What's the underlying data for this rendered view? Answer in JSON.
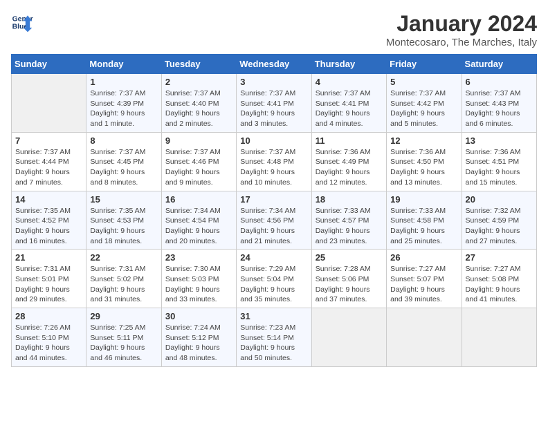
{
  "header": {
    "logo_line1": "General",
    "logo_line2": "Blue",
    "title": "January 2024",
    "subtitle": "Montecosaro, The Marches, Italy"
  },
  "days_of_week": [
    "Sunday",
    "Monday",
    "Tuesday",
    "Wednesday",
    "Thursday",
    "Friday",
    "Saturday"
  ],
  "weeks": [
    [
      {
        "day": "",
        "info": ""
      },
      {
        "day": "1",
        "info": "Sunrise: 7:37 AM\nSunset: 4:39 PM\nDaylight: 9 hours\nand 1 minute."
      },
      {
        "day": "2",
        "info": "Sunrise: 7:37 AM\nSunset: 4:40 PM\nDaylight: 9 hours\nand 2 minutes."
      },
      {
        "day": "3",
        "info": "Sunrise: 7:37 AM\nSunset: 4:41 PM\nDaylight: 9 hours\nand 3 minutes."
      },
      {
        "day": "4",
        "info": "Sunrise: 7:37 AM\nSunset: 4:41 PM\nDaylight: 9 hours\nand 4 minutes."
      },
      {
        "day": "5",
        "info": "Sunrise: 7:37 AM\nSunset: 4:42 PM\nDaylight: 9 hours\nand 5 minutes."
      },
      {
        "day": "6",
        "info": "Sunrise: 7:37 AM\nSunset: 4:43 PM\nDaylight: 9 hours\nand 6 minutes."
      }
    ],
    [
      {
        "day": "7",
        "info": "Sunrise: 7:37 AM\nSunset: 4:44 PM\nDaylight: 9 hours\nand 7 minutes."
      },
      {
        "day": "8",
        "info": "Sunrise: 7:37 AM\nSunset: 4:45 PM\nDaylight: 9 hours\nand 8 minutes."
      },
      {
        "day": "9",
        "info": "Sunrise: 7:37 AM\nSunset: 4:46 PM\nDaylight: 9 hours\nand 9 minutes."
      },
      {
        "day": "10",
        "info": "Sunrise: 7:37 AM\nSunset: 4:48 PM\nDaylight: 9 hours\nand 10 minutes."
      },
      {
        "day": "11",
        "info": "Sunrise: 7:36 AM\nSunset: 4:49 PM\nDaylight: 9 hours\nand 12 minutes."
      },
      {
        "day": "12",
        "info": "Sunrise: 7:36 AM\nSunset: 4:50 PM\nDaylight: 9 hours\nand 13 minutes."
      },
      {
        "day": "13",
        "info": "Sunrise: 7:36 AM\nSunset: 4:51 PM\nDaylight: 9 hours\nand 15 minutes."
      }
    ],
    [
      {
        "day": "14",
        "info": "Sunrise: 7:35 AM\nSunset: 4:52 PM\nDaylight: 9 hours\nand 16 minutes."
      },
      {
        "day": "15",
        "info": "Sunrise: 7:35 AM\nSunset: 4:53 PM\nDaylight: 9 hours\nand 18 minutes."
      },
      {
        "day": "16",
        "info": "Sunrise: 7:34 AM\nSunset: 4:54 PM\nDaylight: 9 hours\nand 20 minutes."
      },
      {
        "day": "17",
        "info": "Sunrise: 7:34 AM\nSunset: 4:56 PM\nDaylight: 9 hours\nand 21 minutes."
      },
      {
        "day": "18",
        "info": "Sunrise: 7:33 AM\nSunset: 4:57 PM\nDaylight: 9 hours\nand 23 minutes."
      },
      {
        "day": "19",
        "info": "Sunrise: 7:33 AM\nSunset: 4:58 PM\nDaylight: 9 hours\nand 25 minutes."
      },
      {
        "day": "20",
        "info": "Sunrise: 7:32 AM\nSunset: 4:59 PM\nDaylight: 9 hours\nand 27 minutes."
      }
    ],
    [
      {
        "day": "21",
        "info": "Sunrise: 7:31 AM\nSunset: 5:01 PM\nDaylight: 9 hours\nand 29 minutes."
      },
      {
        "day": "22",
        "info": "Sunrise: 7:31 AM\nSunset: 5:02 PM\nDaylight: 9 hours\nand 31 minutes."
      },
      {
        "day": "23",
        "info": "Sunrise: 7:30 AM\nSunset: 5:03 PM\nDaylight: 9 hours\nand 33 minutes."
      },
      {
        "day": "24",
        "info": "Sunrise: 7:29 AM\nSunset: 5:04 PM\nDaylight: 9 hours\nand 35 minutes."
      },
      {
        "day": "25",
        "info": "Sunrise: 7:28 AM\nSunset: 5:06 PM\nDaylight: 9 hours\nand 37 minutes."
      },
      {
        "day": "26",
        "info": "Sunrise: 7:27 AM\nSunset: 5:07 PM\nDaylight: 9 hours\nand 39 minutes."
      },
      {
        "day": "27",
        "info": "Sunrise: 7:27 AM\nSunset: 5:08 PM\nDaylight: 9 hours\nand 41 minutes."
      }
    ],
    [
      {
        "day": "28",
        "info": "Sunrise: 7:26 AM\nSunset: 5:10 PM\nDaylight: 9 hours\nand 44 minutes."
      },
      {
        "day": "29",
        "info": "Sunrise: 7:25 AM\nSunset: 5:11 PM\nDaylight: 9 hours\nand 46 minutes."
      },
      {
        "day": "30",
        "info": "Sunrise: 7:24 AM\nSunset: 5:12 PM\nDaylight: 9 hours\nand 48 minutes."
      },
      {
        "day": "31",
        "info": "Sunrise: 7:23 AM\nSunset: 5:14 PM\nDaylight: 9 hours\nand 50 minutes."
      },
      {
        "day": "",
        "info": ""
      },
      {
        "day": "",
        "info": ""
      },
      {
        "day": "",
        "info": ""
      }
    ]
  ]
}
